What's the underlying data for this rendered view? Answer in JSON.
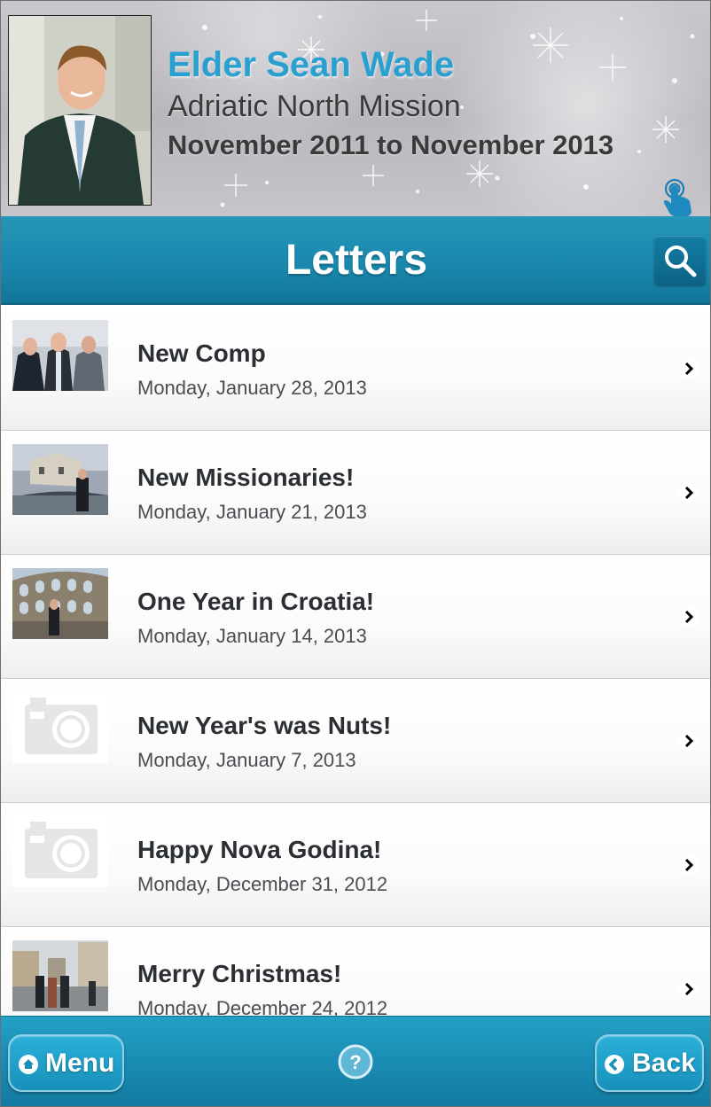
{
  "profile": {
    "name": "Elder Sean Wade",
    "mission": "Adriatic North Mission",
    "dates": "November 2011 to November 2013"
  },
  "titlebar": {
    "title": "Letters",
    "search_icon": "search-icon"
  },
  "letters": [
    {
      "title": "New Comp",
      "date": "Monday, January 28, 2013",
      "thumb": "photo"
    },
    {
      "title": "New Missionaries!",
      "date": "Monday, January 21, 2013",
      "thumb": "photo"
    },
    {
      "title": "One Year in Croatia!",
      "date": "Monday, January 14, 2013",
      "thumb": "photo"
    },
    {
      "title": "New Year's was Nuts!",
      "date": "Monday, January 7, 2013",
      "thumb": "camera-placeholder"
    },
    {
      "title": "Happy Nova Godina!",
      "date": "Monday, December 31, 2012",
      "thumb": "camera-placeholder"
    },
    {
      "title": "Merry Christmas!",
      "date": "Monday, December 24, 2012",
      "thumb": "photo"
    }
  ],
  "footer": {
    "menu_label": "Menu",
    "back_label": "Back",
    "help_icon": "help-icon"
  },
  "colors": {
    "accent_blue": "#1a88ad",
    "name_blue": "#2aa0d0",
    "text_dark": "#2b2f33"
  }
}
